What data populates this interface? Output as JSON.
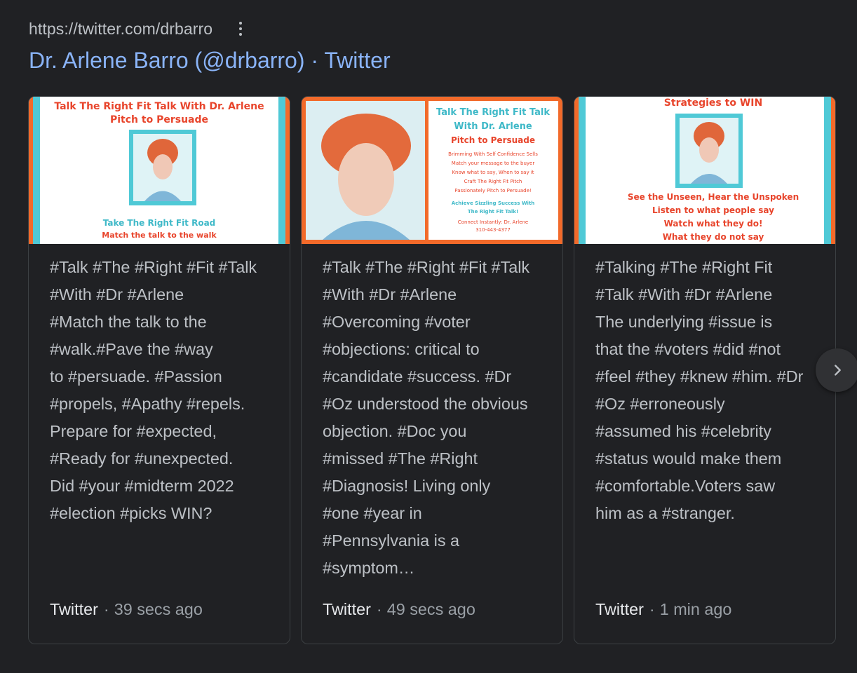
{
  "result": {
    "url": "https://twitter.com/drbarro",
    "title": "Dr. Arlene Barro (@drbarro) · Twitter"
  },
  "cards": [
    {
      "thumb": {
        "heading1": "Talk The Right Fit Talk With Dr. Arlene",
        "heading2": "Pitch to Persuade",
        "sub1": "Take The Right Fit Road",
        "sub2": "Match the talk to the walk"
      },
      "text": "#Talk #The #Right #Fit #Talk\n#With #Dr #Arlene\n#Match the talk to the\n#walk.#Pave the #way\nto #persuade. #Passion\n#propels, #Apathy #repels.\nPrepare for #expected,\n#Ready for #unexpected.\nDid #your #midterm 2022\n#election #picks WIN?",
      "source": "Twitter",
      "separator": "·",
      "time": "39 secs ago"
    },
    {
      "thumb": {
        "heading1": "Talk The Right Fit Talk",
        "heading2": "With Dr. Arlene",
        "heading3": "Pitch to Persuade",
        "lines": [
          "Brimming With Self Confidence Sells",
          "Match your message to the buyer",
          "Know what to say, When to say it",
          "Craft The Right Fit Pitch",
          "Passionately Pitch to Persuade!",
          "Achieve Sizzling Success With",
          "The Right Fit Talk!",
          "Connect Instantly: Dr. Arlene",
          "310-443-4377"
        ]
      },
      "text": "#Talk #The #Right #Fit #Talk\n#With #Dr #Arlene\n#Overcoming #voter\n#objections: critical to\n#candidate #success. #Dr\n#Oz understood the obvious\nobjection. #Doc you\n#missed #The #Right\n#Diagnosis! Living only\n#one #year in\n#Pennsylvania is a\n#symptom…",
      "source": "Twitter",
      "separator": "·",
      "time": "49 secs ago"
    },
    {
      "thumb": {
        "heading1": "Strategies to WIN",
        "lines": [
          "See the Unseen, Hear the Unspoken",
          "Listen to what people say",
          "Watch what they do!",
          "What they do not say"
        ]
      },
      "text": "#Talking #The #Right Fit\n#Talk #With #Dr #Arlene\nThe underlying #issue is\nthat the #voters #did #not\n#feel #they #knew #him. #Dr\n#Oz #erroneously\n#assumed his #celebrity\n#status would make them\n#comfortable.Voters saw\nhim as a #stranger.",
      "source": "Twitter",
      "separator": "·",
      "time": "1 min ago"
    }
  ],
  "icons": {
    "more": "more-vert-icon",
    "next": "chevron-right-icon"
  },
  "colors": {
    "background": "#202124",
    "link": "#8ab4f8",
    "text": "#bdc1c6",
    "thumb_orange": "#f26a2a",
    "thumb_cyan": "#4fc9d6",
    "thumb_red": "#e8452c"
  }
}
